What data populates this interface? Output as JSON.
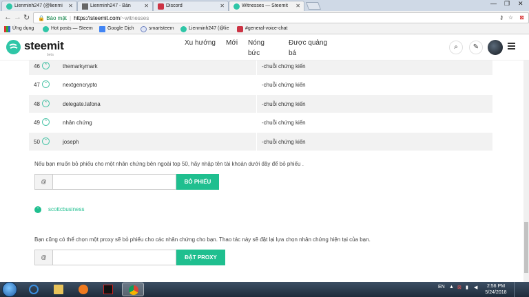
{
  "browser": {
    "tabs": [
      {
        "title": "Lienminh247 (@lienmi"
      },
      {
        "title": "Lienminh247 - Bản"
      },
      {
        "title": "Discord"
      },
      {
        "title": "Witnesses — Steemit"
      }
    ],
    "address": {
      "security_label": "Bảo mật",
      "host": "https://steemit.com",
      "path": "/~witnesses"
    },
    "bookmarks": [
      {
        "label": "Ứng dụng"
      },
      {
        "label": "Hot posts — Steem"
      },
      {
        "label": "Google Dịch"
      },
      {
        "label": "smartsteem"
      },
      {
        "label": "Lienminh247 (@lie"
      },
      {
        "label": "#general-voice-chat"
      }
    ]
  },
  "site": {
    "logo_text": "steemit",
    "logo_beta": "beta",
    "nav": [
      {
        "label": "Xu hướng"
      },
      {
        "label": "Mới"
      },
      {
        "label": "Nóng bức"
      },
      {
        "label": "Được quảng bá"
      }
    ]
  },
  "witnesses": {
    "rows": [
      {
        "rank": "46",
        "name": "themarkymark",
        "status": "-chuỗi chứng kiến"
      },
      {
        "rank": "47",
        "name": "nextgencrypto",
        "status": "-chuỗi chứng kiến"
      },
      {
        "rank": "48",
        "name": "delegate.lafona",
        "status": "-chuỗi chứng kiến"
      },
      {
        "rank": "49",
        "name": "nhân chứng",
        "status": "-chuỗi chứng kiến"
      },
      {
        "rank": "50",
        "name": "joseph",
        "status": "-chuỗi chứng kiến"
      }
    ],
    "vote_instruction": "Nếu bạn muốn bỏ phiếu cho một nhân chứng bên ngoài top 50, hãy nhập tên tài khoản dưới đây để bỏ phiếu .",
    "at_symbol": "@",
    "vote_input_value": "",
    "vote_button": "BỎ PHIẾU",
    "current_vote_name": "scottcbusiness",
    "proxy_instruction": "Bạn cũng có thể chọn một proxy sẽ bỏ phiếu cho các nhân chứng cho bạn. Thao tác này sẽ đặt lại lựa chọn nhân chứng hiện tại của bạn.",
    "proxy_input_value": "",
    "proxy_button": "ĐẶT PROXY"
  },
  "taskbar": {
    "language": "EN",
    "time": "2:56 PM",
    "date": "5/24/2018"
  },
  "colors": {
    "accent": "#1fbf8f",
    "row_alt": "#f2f2f2"
  }
}
